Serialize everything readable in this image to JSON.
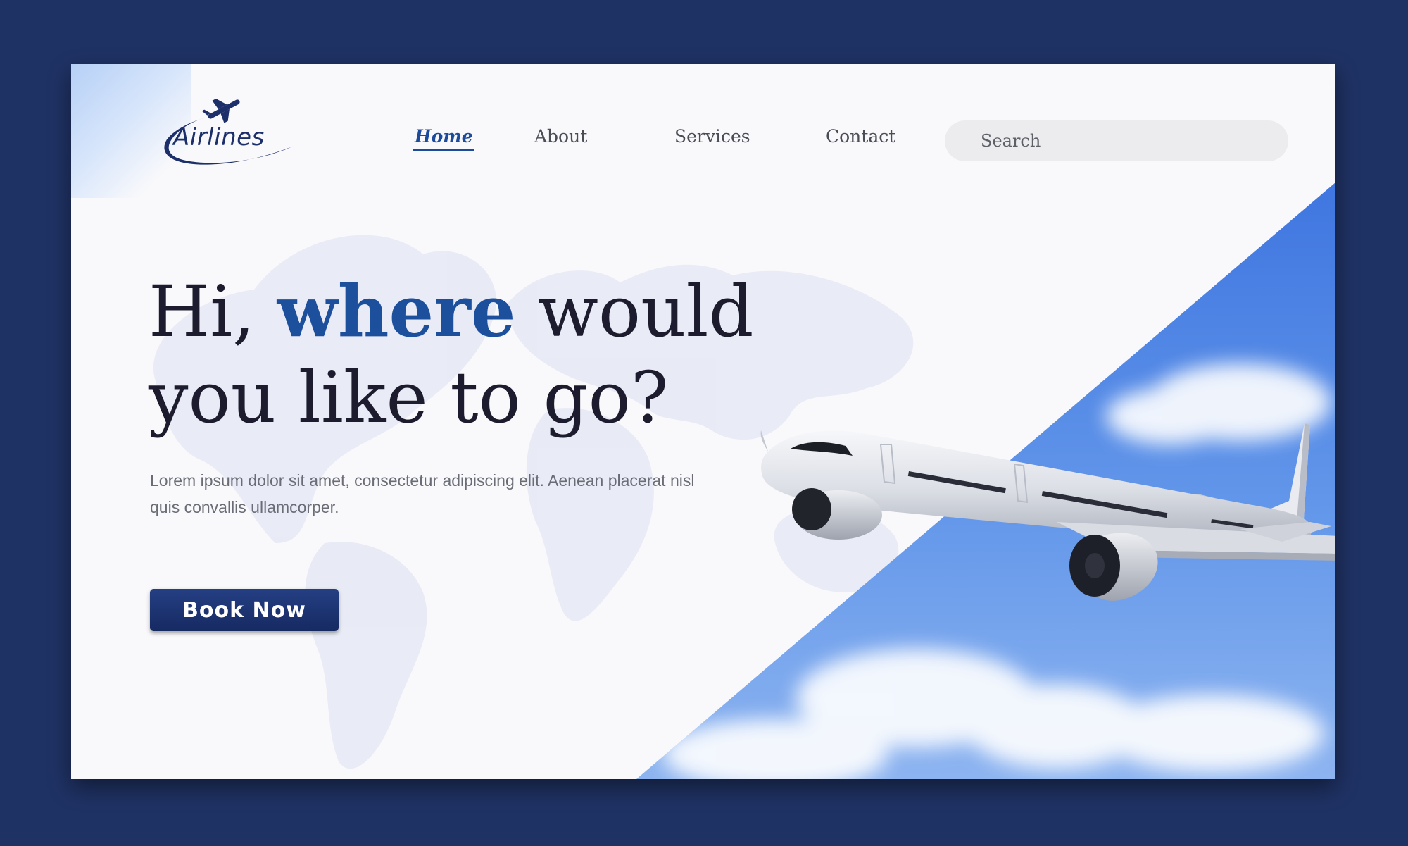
{
  "brand": {
    "logo_text": "Airlines"
  },
  "nav": {
    "items": [
      {
        "label": "Home",
        "active": true
      },
      {
        "label": "About",
        "active": false
      },
      {
        "label": "Services",
        "active": false
      },
      {
        "label": "Contact",
        "active": false
      }
    ]
  },
  "search": {
    "placeholder": "Search"
  },
  "hero": {
    "headline_start": "Hi, ",
    "headline_accent": "where",
    "headline_mid": " would",
    "headline_line2": "you like to go?",
    "description": "Lorem ipsum dolor sit amet, consectetur adipiscing elit. Aenean placerat nisl quis convallis ullamcorper.",
    "button_label": "Book Now"
  },
  "colors": {
    "page_background": "#1f3264",
    "accent": "#1c4f9c",
    "button": "#1c3474",
    "sky": "#5b8fe6"
  }
}
